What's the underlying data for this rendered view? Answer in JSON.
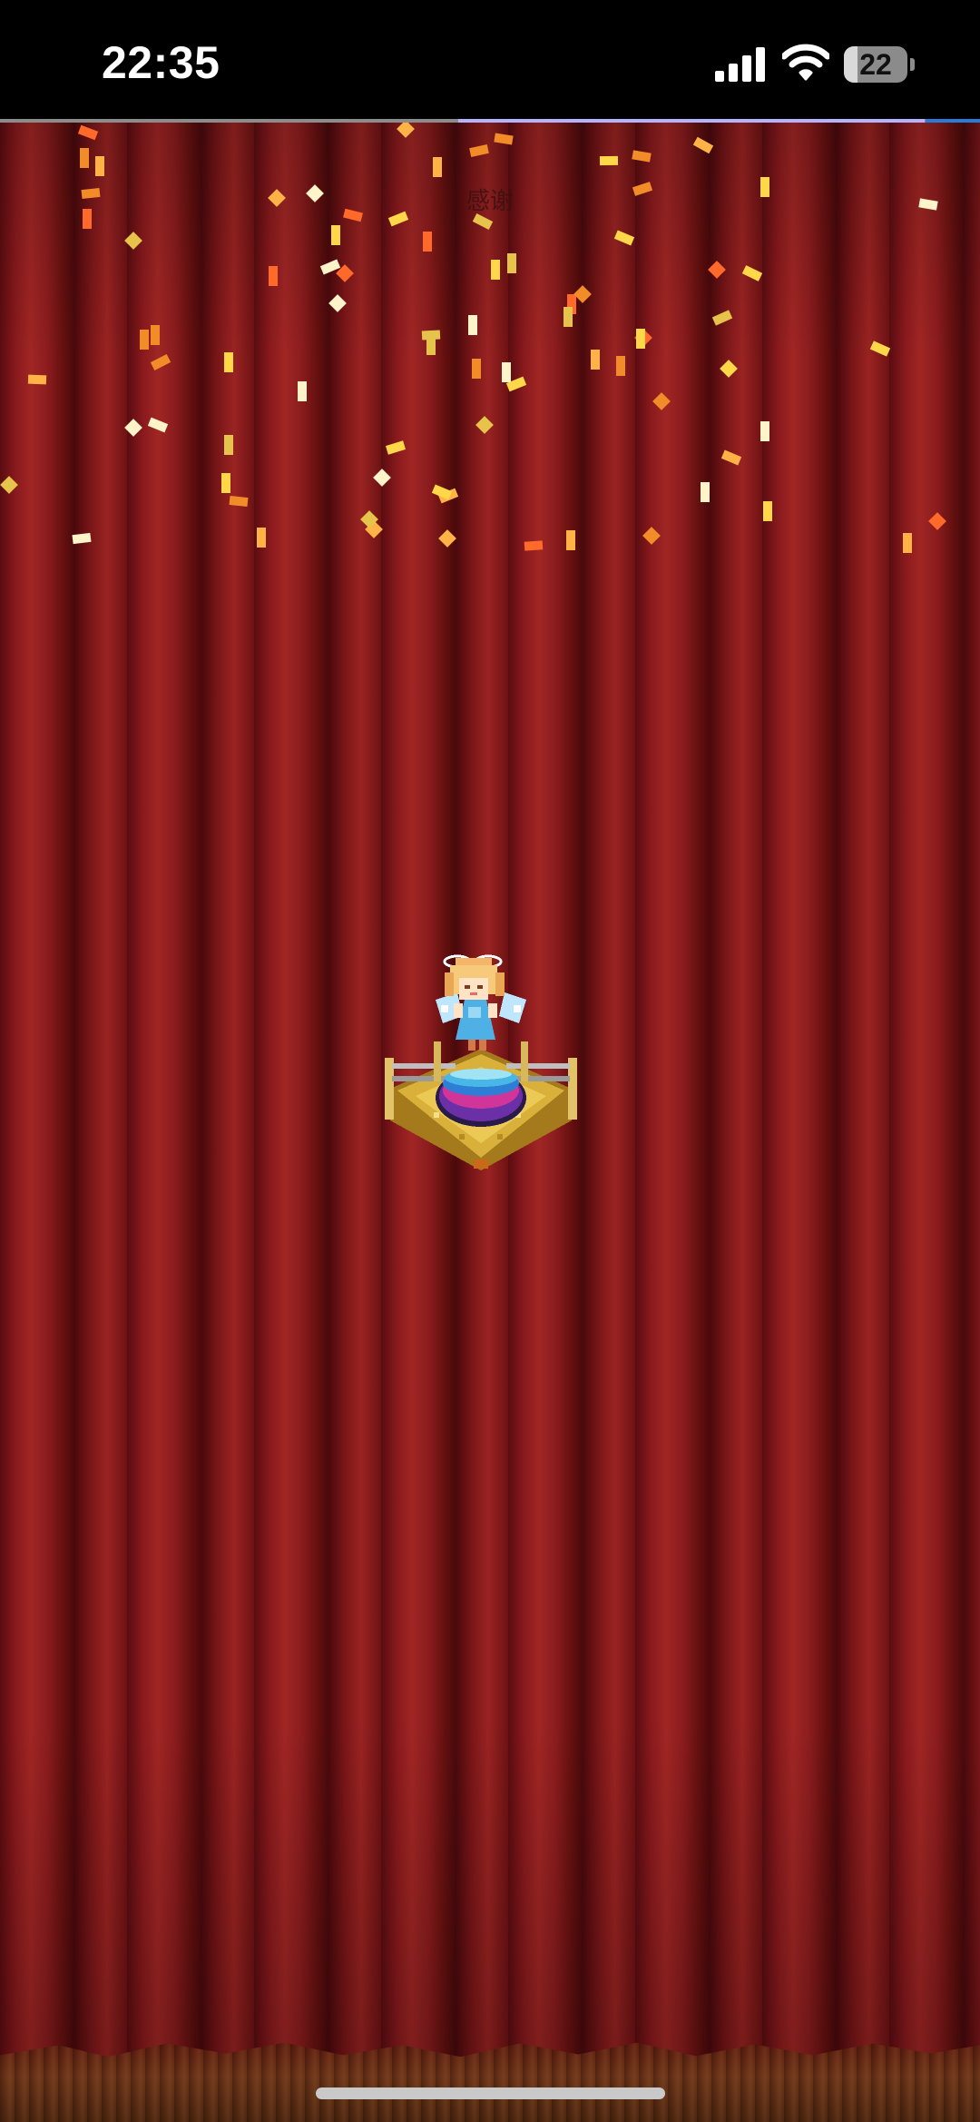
{
  "status_bar": {
    "time": "22:35",
    "battery_level": "22",
    "battery_fraction": 0.22,
    "icons": [
      "signal-icon",
      "wifi-icon",
      "battery-icon"
    ]
  },
  "game": {
    "caption": "感谢",
    "load_progress": {
      "start_fraction": 0.468,
      "end_fraction": 0.944
    },
    "scene": {
      "background": "red-theatre-curtain",
      "sprite": "angel-fairy-on-golden-cauldron-altar",
      "effects": "falling-confetti"
    },
    "colors": {
      "curtain_dark": "#4a090c",
      "curtain_light": "#a02624",
      "progress_fill": "#b5b3ff",
      "progress_tail": "#2a7bd8",
      "confetti": [
        "#ffd84a",
        "#f28c28",
        "#ffb347",
        "#fff3c9",
        "#ff6a2b",
        "#e6c34a"
      ]
    }
  },
  "home_indicator": {
    "name": "home-bar"
  }
}
